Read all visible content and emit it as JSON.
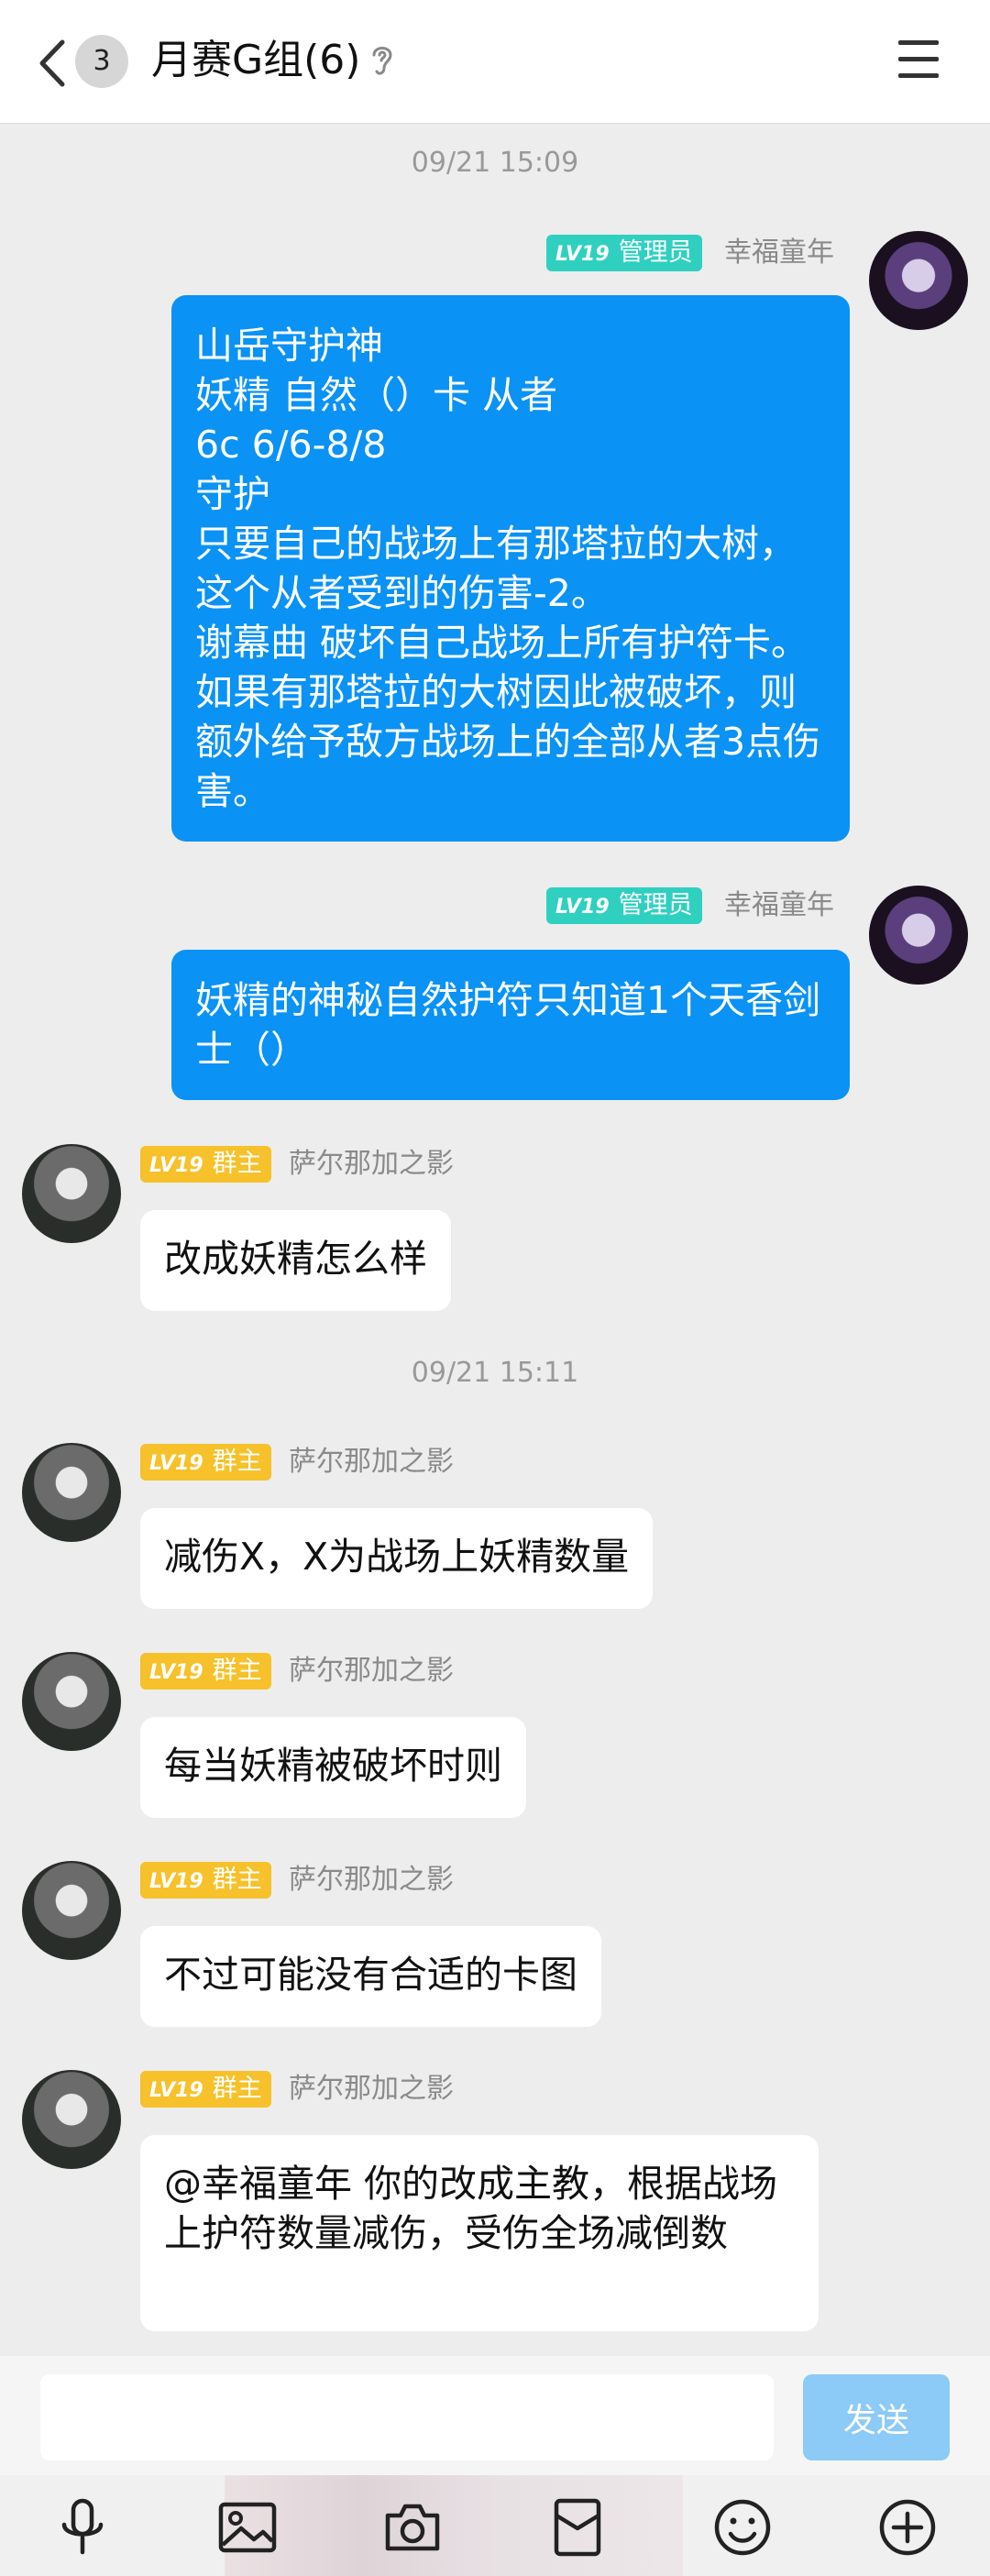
{
  "header": {
    "unread_count": "3",
    "title": "月赛G组(6)",
    "icons": [
      "back-arrow-icon",
      "ear-icon",
      "menu-icon"
    ]
  },
  "timestamps": [
    "09/21 15:09",
    "09/21 15:11"
  ],
  "messages": [
    {
      "side": "right",
      "level": "LV19",
      "role": "管理员",
      "sender": "幸福童年",
      "text": "山岳守护神\n妖精 自然（）卡 从者\n6c 6/6-8/8\n守护\n只要自己的战场上有那塔拉的大树，这个从者受到的伤害-2。\n谢幕曲 破坏自己战场上所有护符卡。如果有那塔拉的大树因此被破坏，则额外给予敌方战场上的全部从者3点伤害。"
    },
    {
      "side": "right",
      "level": "LV19",
      "role": "管理员",
      "sender": "幸福童年",
      "text": "妖精的神秘自然护符只知道1个天香剑士（）"
    },
    {
      "side": "left",
      "level": "LV19",
      "role": "群主",
      "sender": "萨尔那加之影",
      "text": "改成妖精怎么样"
    },
    {
      "side": "left",
      "level": "LV19",
      "role": "群主",
      "sender": "萨尔那加之影",
      "text": "减伤X，X为战场上妖精数量"
    },
    {
      "side": "left",
      "level": "LV19",
      "role": "群主",
      "sender": "萨尔那加之影",
      "text": "每当妖精被破坏时则"
    },
    {
      "side": "left",
      "level": "LV19",
      "role": "群主",
      "sender": "萨尔那加之影",
      "text": "不过可能没有合适的卡图"
    },
    {
      "side": "left",
      "level": "LV19",
      "role": "群主",
      "sender": "萨尔那加之影",
      "text": "@幸福童年 你的改成主教，根据战场上护符数量减伤，受伤全场减倒数"
    }
  ],
  "input": {
    "value": "",
    "send_label": "发送"
  },
  "toolbar": [
    "microphone-icon",
    "image-icon",
    "camera-icon",
    "red-packet-icon",
    "emoji-icon",
    "plus-icon"
  ],
  "colors": {
    "outgoing_bubble": "#0a92f5",
    "admin_badge": "#2fd0c0",
    "owner_badge": "#f6c12a",
    "send_button": "#8ccaf7"
  }
}
